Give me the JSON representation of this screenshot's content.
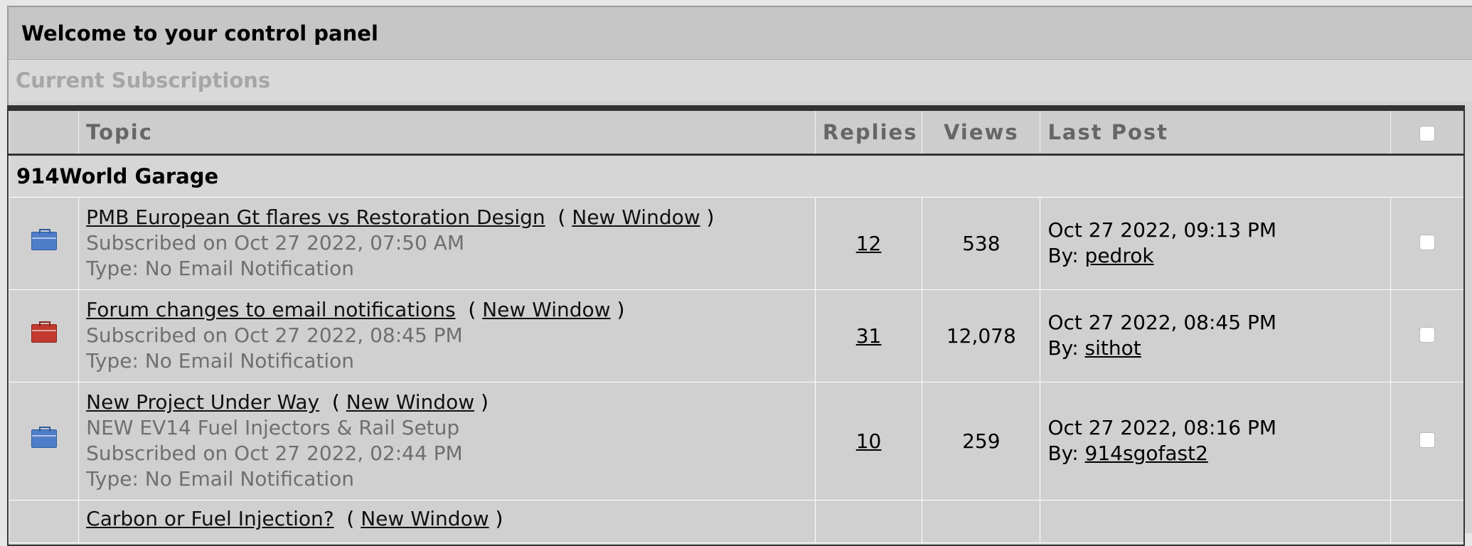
{
  "header": {
    "title": "Welcome to your control panel",
    "subtitle": "Current Subscriptions"
  },
  "table": {
    "columns": {
      "topic": "Topic",
      "replies": "Replies",
      "views": "Views",
      "last_post": "Last Post"
    },
    "forum_name": "914World Garage",
    "rows": [
      {
        "icon": "folder-blue-icon",
        "title": "PMB European Gt flares vs Restoration Design",
        "new_window": "New Window",
        "description": "",
        "subscribed": "Subscribed on Oct 27 2022, 07:50 AM",
        "type": "Type: No Email Notification",
        "replies": "12",
        "views": "538",
        "last_post_date": "Oct 27 2022, 09:13 PM",
        "by_label": "By:",
        "last_post_author": "pedrok"
      },
      {
        "icon": "folder-red-icon",
        "title": "Forum changes to email notifications",
        "new_window": "New Window",
        "description": "",
        "subscribed": "Subscribed on Oct 27 2022, 08:45 PM",
        "type": "Type: No Email Notification",
        "replies": "31",
        "views": "12,078",
        "last_post_date": "Oct 27 2022, 08:45 PM",
        "by_label": "By:",
        "last_post_author": "sithot"
      },
      {
        "icon": "folder-blue-icon",
        "title": "New Project Under Way",
        "new_window": "New Window",
        "description": "NEW EV14 Fuel Injectors & Rail Setup",
        "subscribed": "Subscribed on Oct 27 2022, 02:44 PM",
        "type": "Type: No Email Notification",
        "replies": "10",
        "views": "259",
        "last_post_date": "Oct 27 2022, 08:16 PM",
        "by_label": "By:",
        "last_post_author": "914sgofast2"
      }
    ],
    "partial_row_title": "Carbon or Fuel Injection?",
    "partial_row_new_window": "New Window"
  },
  "colors": {
    "panel_bg": "#d4d4d4",
    "header_bg": "#c6c6c6",
    "folder_blue": "#4f7ec8",
    "folder_red": "#c23a2f"
  }
}
